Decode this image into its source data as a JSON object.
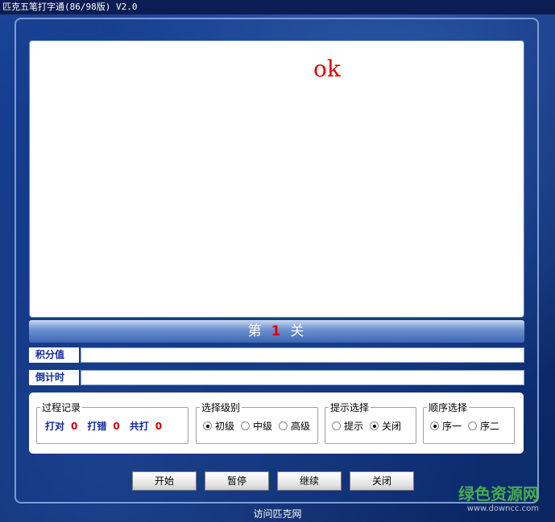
{
  "window": {
    "title": "匹克五笔打字通(86/98版) V2.0"
  },
  "display": {
    "text": "ok"
  },
  "level": {
    "prefix": "第",
    "number": "1",
    "suffix": "关"
  },
  "fields": {
    "score_label": "积分值",
    "score_value": "",
    "countdown_label": "倒计时",
    "countdown_value": ""
  },
  "process_record": {
    "legend": "过程记录",
    "correct_label": "打对",
    "correct_value": "0",
    "wrong_label": "打错",
    "wrong_value": "0",
    "total_label": "共打",
    "total_value": "0"
  },
  "difficulty": {
    "legend": "选择级别",
    "options": [
      "初级",
      "中级",
      "高级"
    ],
    "selected": "初级"
  },
  "hint": {
    "legend": "提示选择",
    "options": [
      "提示",
      "关闭"
    ],
    "selected": "关闭"
  },
  "order": {
    "legend": "顺序选择",
    "options": [
      "序一",
      "序二"
    ],
    "selected": "序一"
  },
  "buttons": {
    "start": "开始",
    "pause": "暂停",
    "resume": "继续",
    "close": "关闭"
  },
  "footer": {
    "link": "访问匹克网"
  },
  "watermark": {
    "cn": "绿色资源网",
    "en": "www.downcc.com"
  }
}
